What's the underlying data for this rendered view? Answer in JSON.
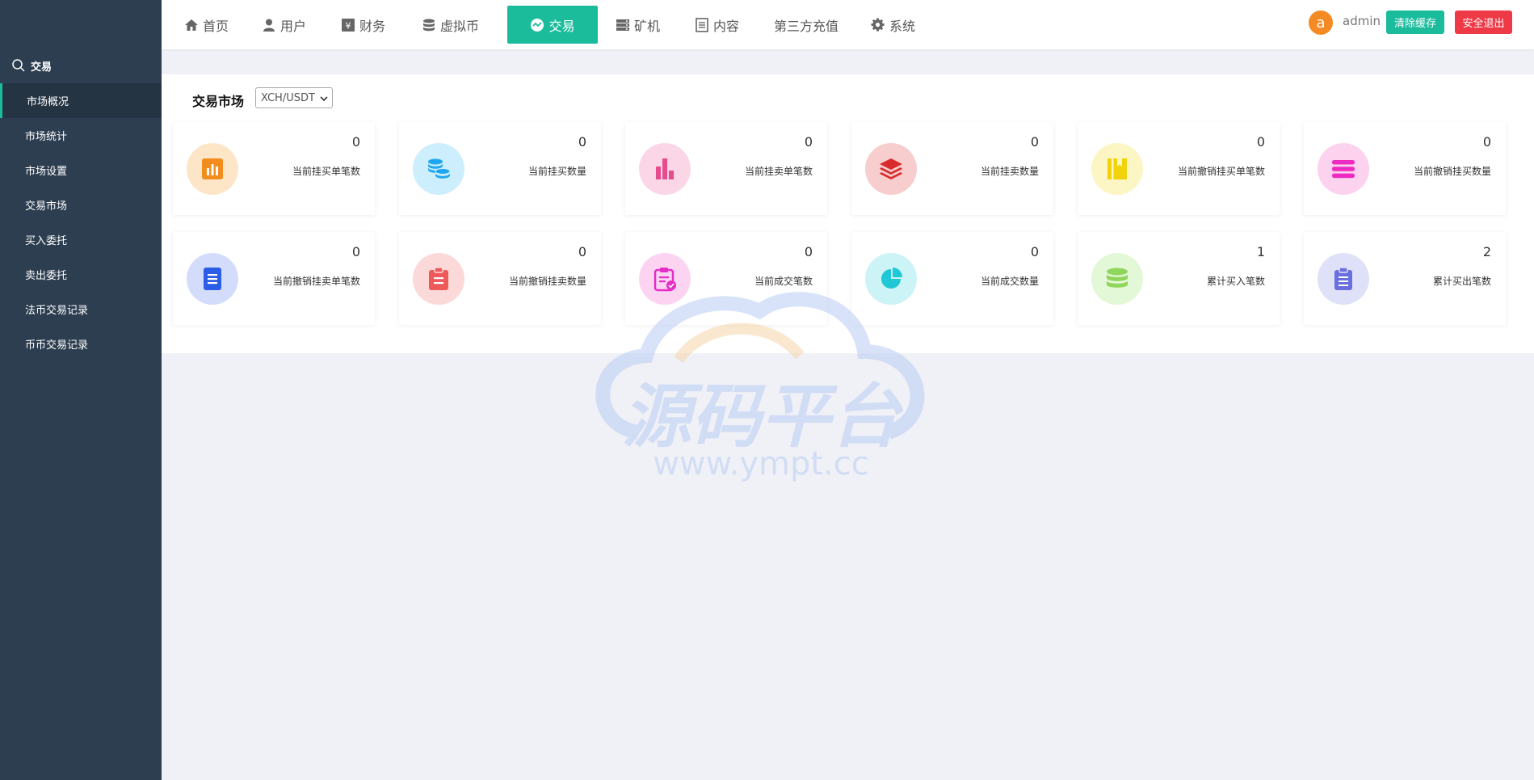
{
  "sidebar": {
    "section_title": "交易",
    "items": [
      {
        "label": "市场概况",
        "active": true
      },
      {
        "label": "市场统计"
      },
      {
        "label": "市场设置"
      },
      {
        "label": "交易市场"
      },
      {
        "label": "买入委托"
      },
      {
        "label": "卖出委托"
      },
      {
        "label": "法币交易记录"
      },
      {
        "label": "币币交易记录"
      }
    ]
  },
  "topnav": {
    "items": [
      {
        "label": "首页",
        "icon": "home-icon"
      },
      {
        "label": "用户",
        "icon": "user-icon"
      },
      {
        "label": "财务",
        "icon": "finance-icon"
      },
      {
        "label": "虚拟币",
        "icon": "database-icon"
      },
      {
        "label": "交易",
        "icon": "exchange-icon",
        "active": true
      },
      {
        "label": "矿机",
        "icon": "server-icon"
      },
      {
        "label": "内容",
        "icon": "document-icon"
      },
      {
        "label": "第三方充值",
        "icon": ""
      },
      {
        "label": "系统",
        "icon": "gear-icon"
      }
    ],
    "avatar_letter": "a",
    "username": "admin",
    "clear_cache": "清除缓存",
    "logout": "安全退出"
  },
  "market": {
    "label": "交易市场",
    "selected": "XCH/USDT"
  },
  "cards": [
    {
      "value": "0",
      "label": "当前挂买单笔数",
      "icon": "bar-chart-icon",
      "bg": "#fde6c8",
      "fg": "#f28c1c"
    },
    {
      "value": "0",
      "label": "当前挂买数量",
      "icon": "coins-icon",
      "bg": "#cdeefc",
      "fg": "#1ea7f0"
    },
    {
      "value": "0",
      "label": "当前挂卖单笔数",
      "icon": "column-chart-icon",
      "bg": "#fbd6e6",
      "fg": "#e54b8d"
    },
    {
      "value": "0",
      "label": "当前挂卖数量",
      "icon": "layers-icon",
      "bg": "#f8cdcd",
      "fg": "#d92b2b"
    },
    {
      "value": "0",
      "label": "当前撤销挂买单笔数",
      "icon": "book-icon",
      "bg": "#fcf5c4",
      "fg": "#f2d30b"
    },
    {
      "value": "0",
      "label": "当前撤销挂买数量",
      "icon": "list-icon",
      "bg": "#fdd2ee",
      "fg": "#ee2bc1"
    },
    {
      "value": "0",
      "label": "当前撤销挂卖单笔数",
      "icon": "document-icon",
      "bg": "#d4dcfb",
      "fg": "#2c5de6"
    },
    {
      "value": "0",
      "label": "当前撤销挂卖数量",
      "icon": "clipboard-icon",
      "bg": "#fcd9d9",
      "fg": "#ee5a5a"
    },
    {
      "value": "0",
      "label": "当前成交笔数",
      "icon": "clipboard-check-icon",
      "bg": "#fcd4f2",
      "fg": "#e52ec6"
    },
    {
      "value": "0",
      "label": "当前成交数量",
      "icon": "pie-chart-icon",
      "bg": "#ccf3f5",
      "fg": "#1fc8d4"
    },
    {
      "value": "1",
      "label": "累计买入笔数",
      "icon": "database-icon",
      "bg": "#e3f8d6",
      "fg": "#8fd65c"
    },
    {
      "value": "2",
      "label": "累计买出笔数",
      "icon": "clipboard-list-icon",
      "bg": "#dfe1f8",
      "fg": "#6a6fe0"
    }
  ],
  "watermark": {
    "title": "源码平台",
    "url": "www.ympt.cc"
  }
}
